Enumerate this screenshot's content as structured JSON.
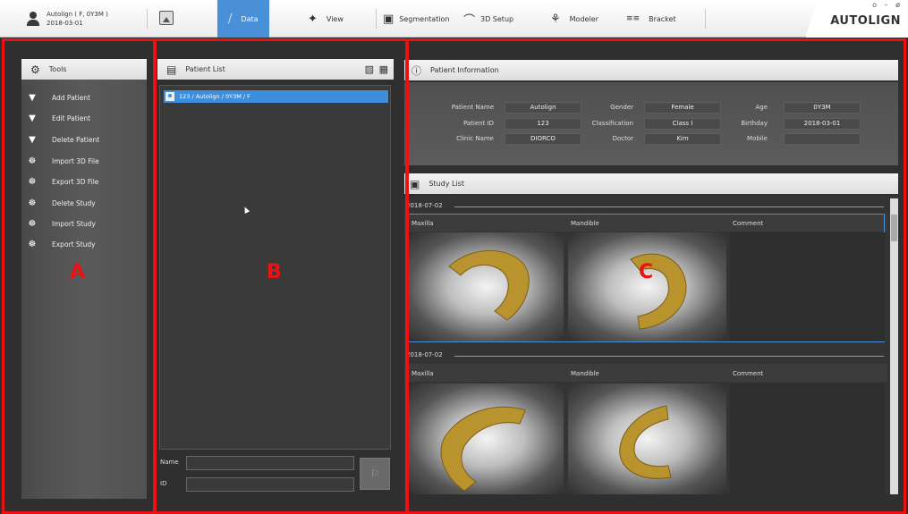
{
  "topbar": {
    "user_name": "Autolign ( F, 0Y3M )",
    "user_date": "2018-03-01",
    "tabs": [
      {
        "label": "Data",
        "icon": "tooth-data-icon"
      },
      {
        "label": "View",
        "icon": "view-icon"
      },
      {
        "label": "Segmentation",
        "icon": "segmentation-icon"
      },
      {
        "label": "3D Setup",
        "icon": "setup-icon"
      },
      {
        "label": "Modeler",
        "icon": "modeler-icon"
      },
      {
        "label": "Bracket",
        "icon": "bracket-icon"
      }
    ],
    "logo": "AUTOLIGN",
    "window_controls": "o – ø"
  },
  "tools": {
    "title": "Tools",
    "items": [
      {
        "label": "Add Patient"
      },
      {
        "label": "Edit Patient"
      },
      {
        "label": "Delete Patient"
      },
      {
        "label": "Import 3D File"
      },
      {
        "label": "Export 3D File"
      },
      {
        "label": "Delete Study"
      },
      {
        "label": "Import Study"
      },
      {
        "label": "Export Study"
      }
    ]
  },
  "patient_list": {
    "title": "Patient List",
    "items": [
      "123 / Autolign / 0Y3M / F"
    ],
    "name_label": "Name",
    "id_label": "ID"
  },
  "patient_info": {
    "title": "Patient Information",
    "fields": {
      "patient_name_label": "Patient Name",
      "patient_name": "Autolign",
      "gender_label": "Gender",
      "gender": "Female",
      "age_label": "Age",
      "age": "0Y3M",
      "patient_id_label": "Patient ID",
      "patient_id": "123",
      "classification_label": "Classification",
      "classification": "Class I",
      "birthday_label": "Birthday",
      "birthday": "2018-03-01",
      "clinic_label": "Clinic Name",
      "clinic": "DIORCO",
      "doctor_label": "Doctor",
      "doctor": "Kim",
      "mobile_label": "Mobile",
      "mobile": ""
    }
  },
  "study_list": {
    "title": "Study List",
    "studies": [
      {
        "date": "2018-07-02",
        "col1": "Maxilla",
        "col2": "Mandible",
        "col3": "Comment"
      },
      {
        "date": "2018-07-02",
        "col1": "Maxilla",
        "col2": "Mandible",
        "col3": "Comment"
      }
    ]
  },
  "annotations": {
    "a": "A",
    "b": "B",
    "c": "C"
  },
  "colors": {
    "accent": "#4a90d9",
    "annotation": "#ee1111"
  }
}
